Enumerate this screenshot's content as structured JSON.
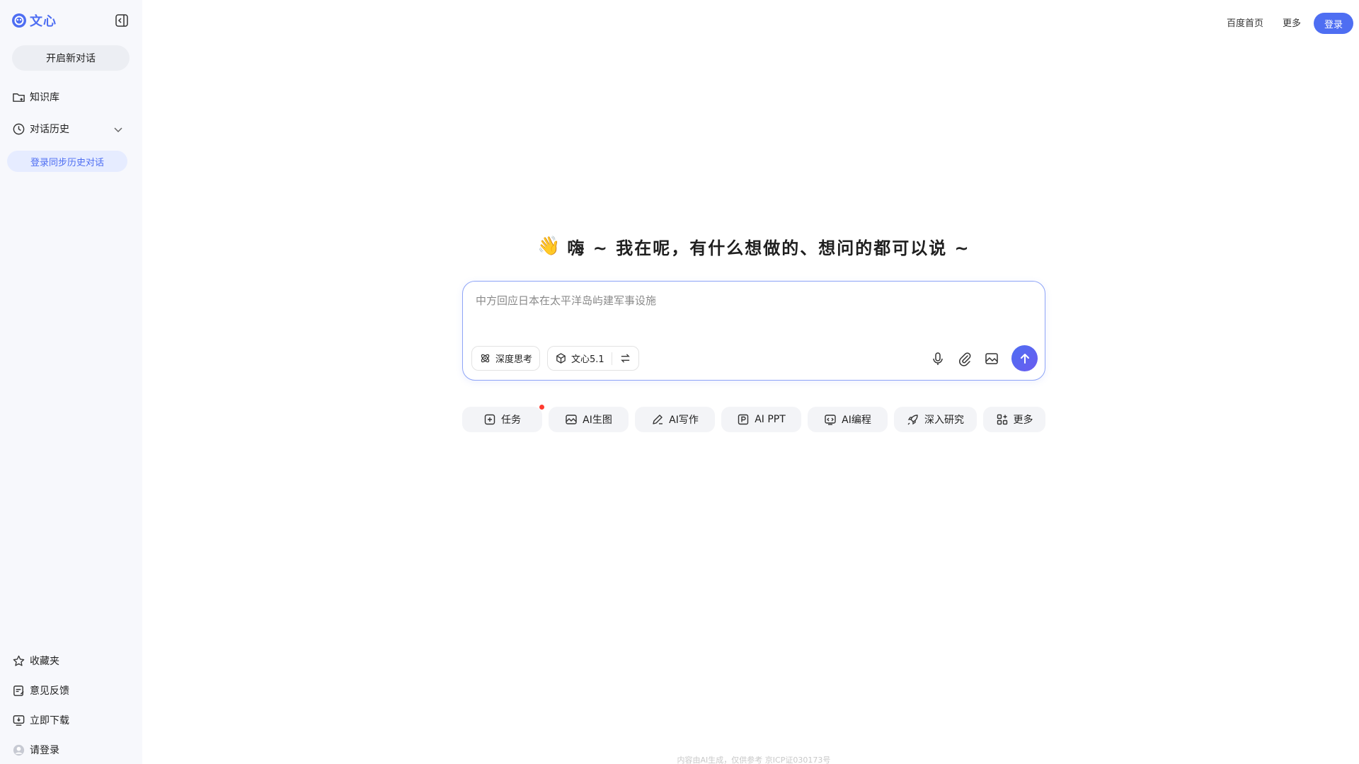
{
  "brand": {
    "name": "文心",
    "accent": "#4e6ef2"
  },
  "sidebar": {
    "new_chat": "开启新对话",
    "items": [
      {
        "label": "知识库",
        "icon": "folder-icon"
      },
      {
        "label": "对话历史",
        "icon": "clock-icon"
      }
    ],
    "login_sync": "登录同步历史对话",
    "bottom": [
      {
        "label": "收藏夹",
        "icon": "star-icon"
      },
      {
        "label": "意见反馈",
        "icon": "feedback-icon"
      },
      {
        "label": "立即下载",
        "icon": "download-icon"
      },
      {
        "label": "请登录",
        "icon": "avatar-icon"
      }
    ]
  },
  "header": {
    "baidu_home": "百度首页",
    "more": "更多",
    "login": "登录"
  },
  "greeting": {
    "emoji": "👋",
    "text": "嗨 ~ 我在呢，有什么想做的、想问的都可以说 ~"
  },
  "input": {
    "placeholder": "中方回应日本在太平洋岛屿建军事设施",
    "deep_think": "深度思考",
    "model": "文心5.1"
  },
  "features": [
    {
      "label": "任务",
      "icon": "task-icon"
    },
    {
      "label": "AI生图",
      "icon": "image-gen-icon"
    },
    {
      "label": "AI写作",
      "icon": "pen-icon"
    },
    {
      "label": "AI PPT",
      "icon": "ppt-icon"
    },
    {
      "label": "AI编程",
      "icon": "code-icon"
    },
    {
      "label": "深入研究",
      "icon": "rocket-icon"
    },
    {
      "label": "更多",
      "icon": "grid-icon"
    }
  ],
  "footer": "内容由AI生成，仅供参考  京ICP证030173号"
}
